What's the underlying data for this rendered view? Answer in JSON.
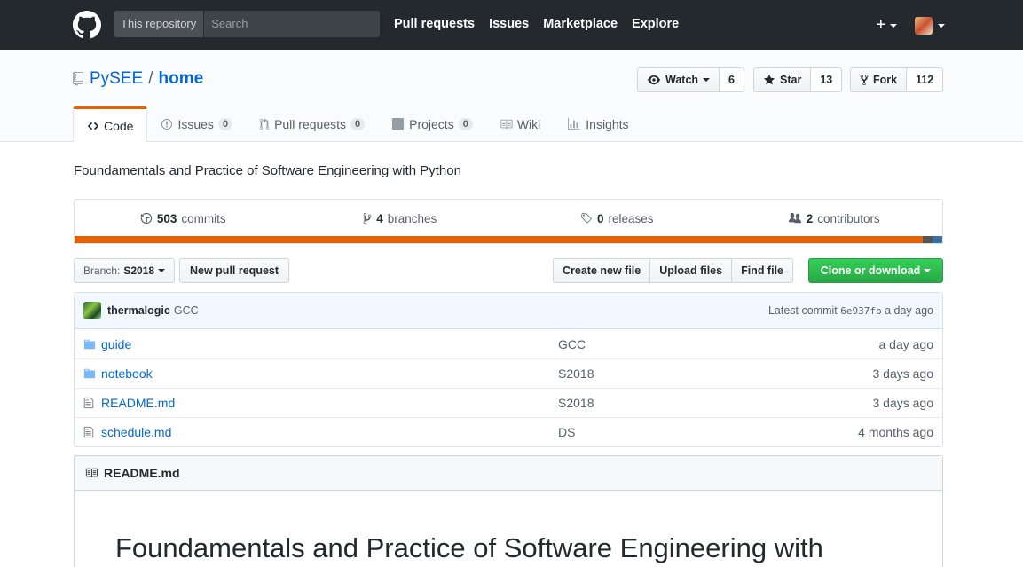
{
  "header": {
    "search_scope": "This repository",
    "search_placeholder": "Search",
    "nav": [
      "Pull requests",
      "Issues",
      "Marketplace",
      "Explore"
    ],
    "plus_label": "+"
  },
  "repo": {
    "owner": "PySEE",
    "separator": "/",
    "name": "home",
    "watch_label": "Watch",
    "watch_count": "6",
    "star_label": "Star",
    "star_count": "13",
    "fork_label": "Fork",
    "fork_count": "112"
  },
  "tabs": [
    {
      "label": "Code",
      "count": null
    },
    {
      "label": "Issues",
      "count": "0"
    },
    {
      "label": "Pull requests",
      "count": "0"
    },
    {
      "label": "Projects",
      "count": "0"
    },
    {
      "label": "Wiki",
      "count": null
    },
    {
      "label": "Insights",
      "count": null
    }
  ],
  "description": "Foundamentals and Practice of Software Engineering with Python",
  "summary": {
    "commits_num": "503",
    "commits_label": "commits",
    "branches_num": "4",
    "branches_label": "branches",
    "releases_num": "0",
    "releases_label": "releases",
    "contributors_num": "2",
    "contributors_label": "contributors"
  },
  "languages": [
    {
      "color": "#e36209",
      "share": 0.978
    },
    {
      "color": "#555555",
      "share": 0.011
    },
    {
      "color": "#3572A5",
      "share": 0.011
    }
  ],
  "filenav": {
    "branch_prefix": "Branch:",
    "branch_name": "S2018",
    "new_pr": "New pull request",
    "create_file": "Create new file",
    "upload_files": "Upload files",
    "find_file": "Find file",
    "clone": "Clone or download"
  },
  "commit": {
    "author": "thermalogic",
    "message": "GCC",
    "latest_label": "Latest commit",
    "sha": "6e937fb",
    "age": "a day ago"
  },
  "files": [
    {
      "type": "dir",
      "name": "guide",
      "message": "GCC",
      "age": "a day ago"
    },
    {
      "type": "dir",
      "name": "notebook",
      "message": "S2018",
      "age": "3 days ago"
    },
    {
      "type": "file",
      "name": "README.md",
      "message": "S2018",
      "age": "3 days ago"
    },
    {
      "type": "file",
      "name": "schedule.md",
      "message": "DS",
      "age": "4 months ago"
    }
  ],
  "readme": {
    "title": "README.md",
    "heading": "Foundamentals and Practice of Software Engineering with"
  }
}
